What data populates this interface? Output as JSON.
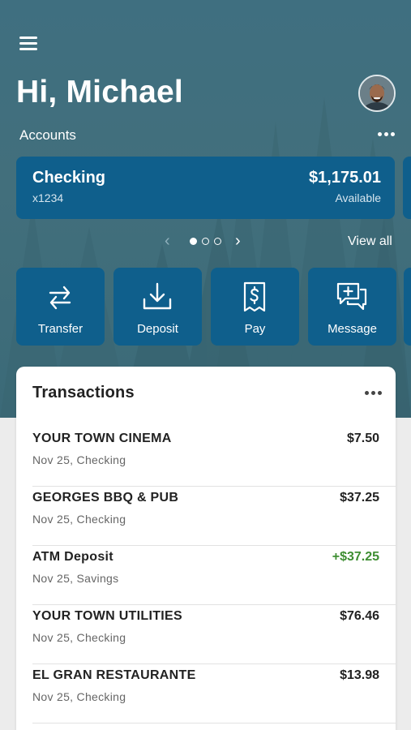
{
  "header": {
    "greeting": "Hi, Michael",
    "accounts_label": "Accounts"
  },
  "account": {
    "name": "Checking",
    "number": "x1234",
    "balance": "$1,175.01",
    "balance_label": "Available"
  },
  "pager": {
    "prev_icon": "‹",
    "next_icon": "›",
    "page_count": 3,
    "active_page": 1,
    "view_all_label": "View all"
  },
  "actions": [
    {
      "label": "Transfer",
      "icon": "transfer-icon"
    },
    {
      "label": "Deposit",
      "icon": "deposit-icon"
    },
    {
      "label": "Pay",
      "icon": "bill-pay-icon"
    },
    {
      "label": "Message",
      "icon": "message-icon"
    }
  ],
  "transactions": {
    "title": "Transactions",
    "items": [
      {
        "name": "YOUR TOWN CINEMA",
        "meta": "Nov 25, Checking",
        "amount": "$7.50",
        "credit": false
      },
      {
        "name": "GEORGES BBQ & PUB",
        "meta": "Nov 25, Checking",
        "amount": "$37.25",
        "credit": false
      },
      {
        "name": "ATM Deposit",
        "meta": "Nov 25, Savings",
        "amount": "+$37.25",
        "credit": true
      },
      {
        "name": "YOUR TOWN UTILITIES",
        "meta": "Nov 25, Checking",
        "amount": "$76.46",
        "credit": false
      },
      {
        "name": "EL GRAN RESTAURANTE",
        "meta": "Nov 25, Checking",
        "amount": "$13.98",
        "credit": false
      }
    ]
  },
  "colors": {
    "hero_background": "#3f6f80",
    "card_blue": "#0f5f8c",
    "credit_green": "#3e8e32",
    "page_background": "#ececec"
  }
}
